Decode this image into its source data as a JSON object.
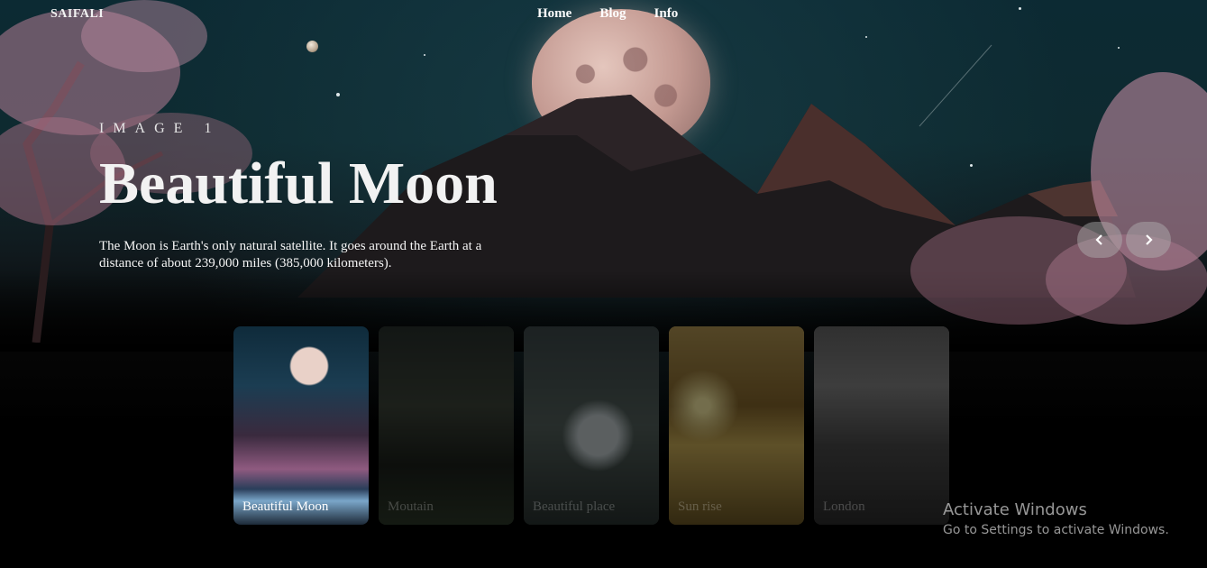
{
  "header": {
    "brand": "SAIFALI",
    "nav": [
      "Home",
      "Blog",
      "Info"
    ]
  },
  "hero": {
    "eyebrow": "IMAGE 1",
    "title": "Beautiful Moon",
    "description": "The Moon is Earth's only natural satellite. It goes around the Earth at a distance of about 239,000 miles (385,000 kilometers)."
  },
  "controls": {
    "prev_icon": "chevron-left-icon",
    "next_icon": "chevron-right-icon"
  },
  "thumbnails": [
    {
      "label": "Beautiful Moon",
      "active": true
    },
    {
      "label": "Moutain",
      "active": false
    },
    {
      "label": "Beautiful place",
      "active": false
    },
    {
      "label": "Sun rise",
      "active": false
    },
    {
      "label": "London",
      "active": false
    }
  ],
  "watermark": {
    "title": "Activate Windows",
    "subtitle": "Go to Settings to activate Windows."
  },
  "colors": {
    "sky": "#0c2a33",
    "blossom": "#c98aa6",
    "background": "#000000"
  }
}
